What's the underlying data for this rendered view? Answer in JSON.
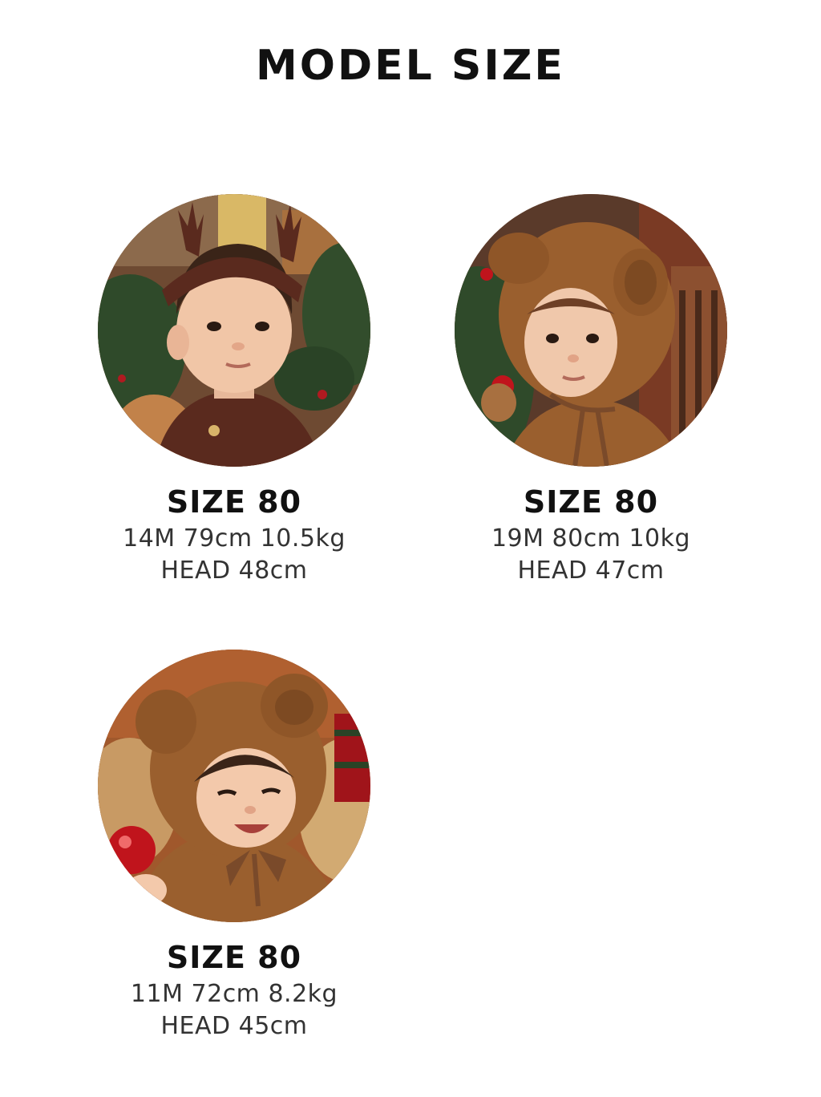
{
  "title": "MODEL SIZE",
  "models": [
    {
      "photo_icon": "baby-reindeer-headband-photo",
      "size": "SIZE 80",
      "stats": "14M 79cm 10.5kg",
      "head": "HEAD 48cm"
    },
    {
      "photo_icon": "baby-bear-hood-photo",
      "size": "SIZE 80",
      "stats": "19M 80cm 10kg",
      "head": "HEAD 47cm"
    },
    {
      "photo_icon": "baby-bear-hoodie-ornament-photo",
      "size": "SIZE 80",
      "stats": "11M 72cm 8.2kg",
      "head": "HEAD 45cm"
    }
  ],
  "colors": {
    "text": "#111111",
    "subtext": "#333333",
    "fleece_brown": "#9a5f2e",
    "knit_brown": "#5a2a1e",
    "pine_green": "#2f4a2a",
    "ornament_red": "#c0141c"
  }
}
